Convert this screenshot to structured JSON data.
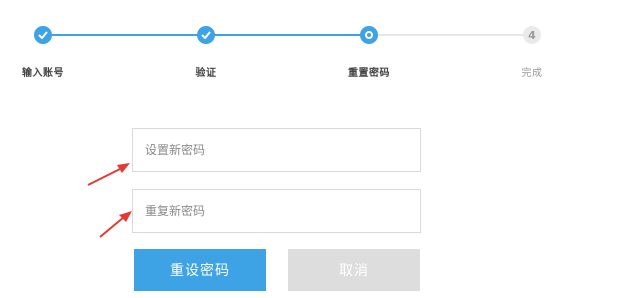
{
  "stepper": {
    "steps": [
      {
        "label": "输入账号",
        "state": "done"
      },
      {
        "label": "验证",
        "state": "done"
      },
      {
        "label": "重置密码",
        "state": "current"
      },
      {
        "label": "完成",
        "state": "todo",
        "number": "4"
      }
    ]
  },
  "form": {
    "new_password_placeholder": "设置新密码",
    "repeat_password_placeholder": "重复新密码",
    "submit_label": "重设密码",
    "cancel_label": "取消"
  },
  "colors": {
    "accent": "#3ea3e5",
    "inactive": "#e6e6e6",
    "annotation_arrow": "#e53935"
  }
}
